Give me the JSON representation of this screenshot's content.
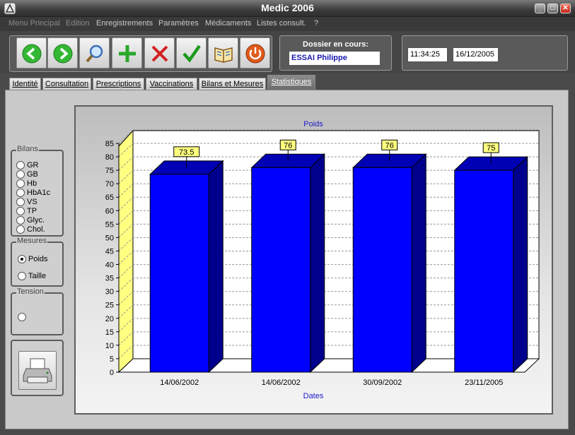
{
  "window": {
    "title": "Medic 2006"
  },
  "menu": [
    "Menu Principal",
    "Edition",
    "Enregistrements",
    "Paramètres",
    "Médicaments",
    "Listes consult.",
    "?"
  ],
  "toolbar": {
    "dossier_label": "Dossier en cours:",
    "dossier_value": "ESSAI Philippe",
    "time": "11:34:25",
    "date": "16/12/2005"
  },
  "tabs": [
    "Identité",
    "Consultation",
    "Prescriptions",
    "Vaccinations",
    "Bilans et Mesures",
    "Statistiques"
  ],
  "sidebar": {
    "bilans": {
      "title": "Bilans",
      "items": [
        "GR",
        "GB",
        "Hb",
        "HbA1c",
        "VS",
        "TP",
        "Glyc.",
        "Chol."
      ]
    },
    "mesures": {
      "title": "Mesures",
      "items": [
        "Poids",
        "Taille"
      ],
      "selected": "Poids"
    },
    "tension": {
      "title": "Tension"
    }
  },
  "colors": {
    "bar_front": "#0000ff",
    "bar_side": "#00008c",
    "bar_top": "#0000b4",
    "wall": "#ffff80",
    "label_bg": "#ffff80",
    "title": "#1a1ac8"
  },
  "chart_data": {
    "type": "bar",
    "title": "Poids",
    "xlabel": "Dates",
    "ylabel": "",
    "categories": [
      "14/06/2002",
      "14/06/2002",
      "30/09/2002",
      "23/11/2005"
    ],
    "values": [
      73.5,
      76,
      76,
      75
    ],
    "data_labels": [
      "73.5",
      "76",
      "76",
      "75"
    ],
    "ylim": [
      0,
      85
    ],
    "yticks": [
      "0",
      "5",
      "10",
      "15",
      "20",
      "25",
      "30",
      "35",
      "40",
      "45",
      "50",
      "55",
      "60",
      "65",
      "70",
      "75",
      "80",
      "85"
    ],
    "grid": true
  }
}
